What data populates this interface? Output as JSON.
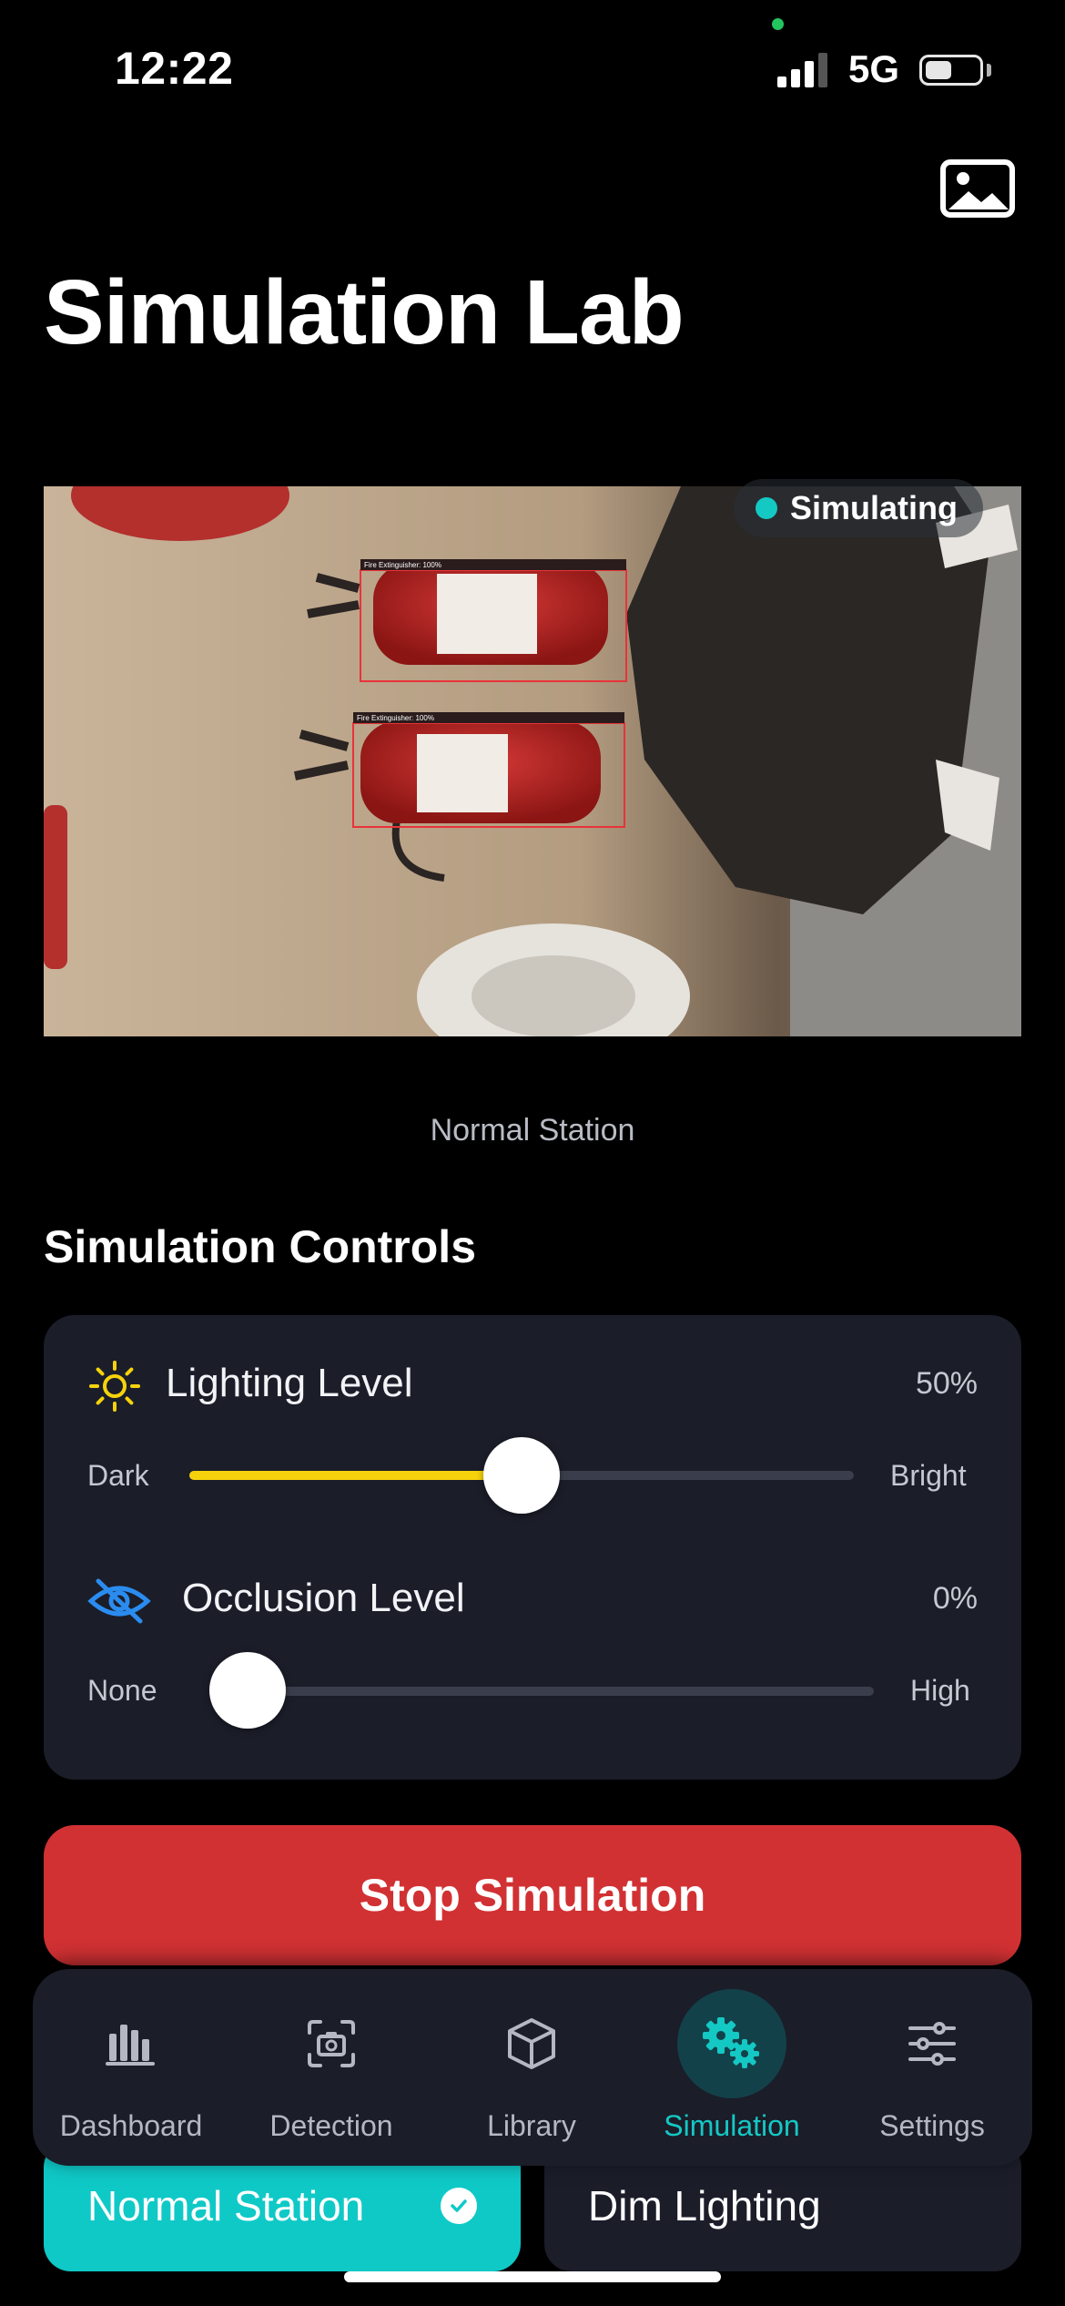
{
  "status_bar": {
    "time": "12:22",
    "network": "5G"
  },
  "header": {
    "title": "Simulation Lab",
    "gallery_icon": "photo-icon"
  },
  "preview": {
    "badge": "Simulating",
    "detections": [
      {
        "label": "Fire Extinguisher: 100%"
      },
      {
        "label": "Fire Extinguisher: 100%"
      }
    ],
    "caption": "Normal Station"
  },
  "controls": {
    "title": "Simulation Controls",
    "lighting": {
      "label": "Lighting Level",
      "value": "50%",
      "level": 0.5,
      "min_label": "Dark",
      "max_label": "Bright",
      "icon": "sun-icon",
      "color": "#f5d20c"
    },
    "occlusion": {
      "label": "Occlusion Level",
      "value": "0%",
      "level": 0.0,
      "min_label": "None",
      "max_label": "High",
      "icon": "eye-slash-icon",
      "color": "#2b8cf0"
    }
  },
  "actions": {
    "stop_label": "Stop Simulation",
    "stop_color": "#d13133"
  },
  "presets": [
    {
      "label": "Normal Station",
      "selected": true
    },
    {
      "label": "Dim Lighting",
      "selected": false
    }
  ],
  "tabs": [
    {
      "label": "Dashboard",
      "icon": "bar-chart-icon",
      "active": false
    },
    {
      "label": "Detection",
      "icon": "camera-icon",
      "active": false
    },
    {
      "label": "Library",
      "icon": "cube-icon",
      "active": false
    },
    {
      "label": "Simulation",
      "icon": "gears-icon",
      "active": true
    },
    {
      "label": "Settings",
      "icon": "sliders-icon",
      "active": false
    }
  ],
  "accent_color": "#14c8c4"
}
